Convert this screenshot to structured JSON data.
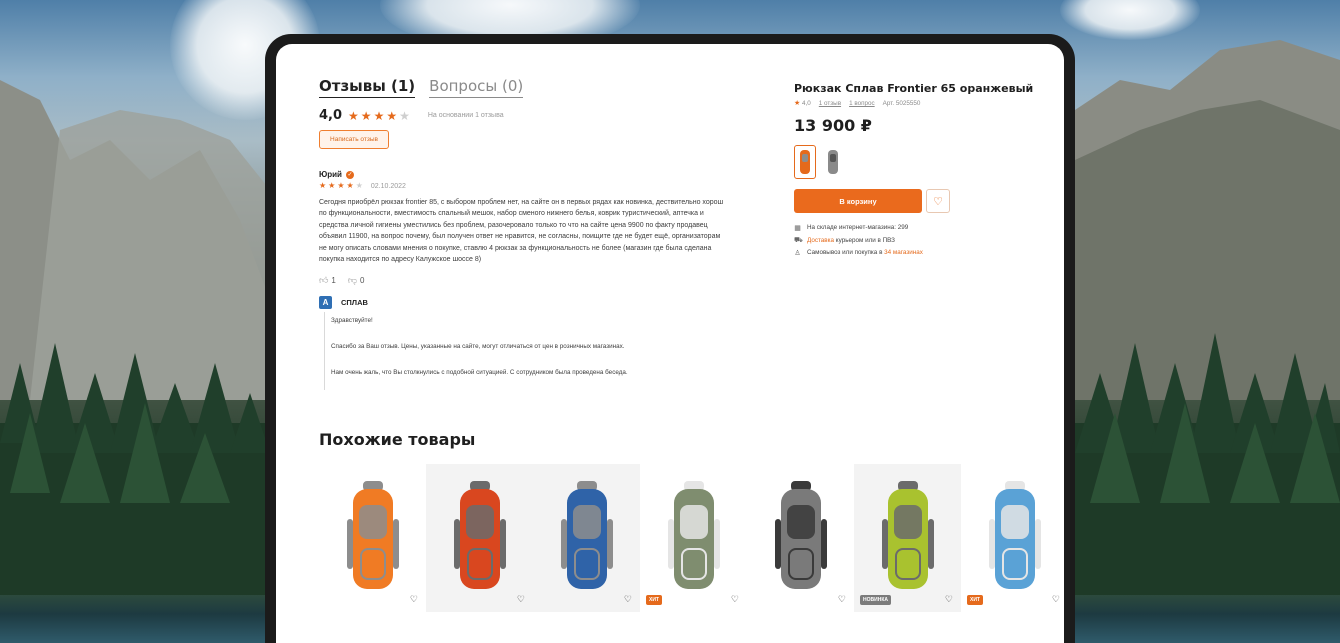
{
  "reviews": {
    "tabs": [
      {
        "label": "Отзывы (1)",
        "active": true
      },
      {
        "label": "Вопросы (0)",
        "active": false
      }
    ],
    "rating": "4,0",
    "stars_filled": 4,
    "based_on": "На основании 1 отзыва",
    "write_button": "Написать отзыв",
    "review": {
      "author": "Юрий",
      "stars_filled": 4,
      "date": "02.10.2022",
      "text": "Сегодня приобрёл рюкзак frontier 85, с выбором проблем нет, на сайте он в первых рядах как новинка, дествительно хорош по функциональности, вместимость спальный мешок, набор сменого нижнего белья, коврик туристический, аптечка и средства личной гигиены уместились без проблем, разочеровало только то что на сайте цена 9900 по факту продавец объявил 11900, на вопрос почему, был получен ответ не нравится, не согласны, поищите где не будет ещё, организаторам не могу описать словами мнения о покупке, ставлю 4 рюкзак за функциональность не более (магазин где была сделана покупка находится по адресу Калужское шоссе 8)",
      "likes": "1",
      "dislikes": "0"
    },
    "reply": {
      "brand": "СПЛАВ",
      "brand_logo_letter": "A",
      "lines": [
        "Здравствуйте!",
        "Спасибо за Ваш отзыв.  Цены, указанные на сайте, могут отличаться от цен в розничных магазинах.",
        "Нам очень жаль, что Вы столкнулись с подобной ситуацией. С сотрудником была проведена беседа."
      ]
    }
  },
  "product": {
    "title": "Рюкзак Сплав Frontier 65 оранжевый",
    "rating": "4,0",
    "reviews_link": "1 отзыв",
    "questions_link": "1 вопрос",
    "article": "Арт. 5025550",
    "price": "13 900 ₽",
    "cart_button": "В корзину",
    "stock": [
      {
        "icon": "warehouse-icon",
        "glyph": "▦",
        "text": "На складе интернет-магазина: 299",
        "link": ""
      },
      {
        "icon": "delivery-icon",
        "glyph": "⛟",
        "text_before": "",
        "link": "Доставка",
        "text": " курьером или в ПВЗ"
      },
      {
        "icon": "walking-icon",
        "glyph": "♙",
        "text": "Самовывоз или покупка в ",
        "link": "34 магазинах"
      }
    ]
  },
  "similar": {
    "title": "Похожие товары",
    "items": [
      {
        "name": "orange-backpack",
        "color": "#f07b24",
        "accent": "#8d8d8d",
        "shade": false,
        "badge": ""
      },
      {
        "name": "red-backpack",
        "color": "#d9471f",
        "accent": "#6b6b6b",
        "shade": true,
        "badge": ""
      },
      {
        "name": "blue-backpack",
        "color": "#2f63a8",
        "accent": "#8d8d8d",
        "shade": true,
        "badge": ""
      },
      {
        "name": "olive-backpack",
        "color": "#7f8d6f",
        "accent": "#e5e5e5",
        "shade": false,
        "badge": "ХИТ"
      },
      {
        "name": "gray-backpack",
        "color": "#7a7a7a",
        "accent": "#3a3a3a",
        "shade": false,
        "badge": ""
      },
      {
        "name": "lime-backpack",
        "color": "#a9c22f",
        "accent": "#6b6b6b",
        "shade": true,
        "badge": "НОВИНКА"
      },
      {
        "name": "light-blue-backpack",
        "color": "#5aa2d6",
        "accent": "#e5e5e5",
        "shade": false,
        "badge": "ХИТ"
      }
    ]
  },
  "colors": {
    "accent": "#ea6a1d",
    "text": "#1f1f1f",
    "muted": "#8a8a8a"
  }
}
